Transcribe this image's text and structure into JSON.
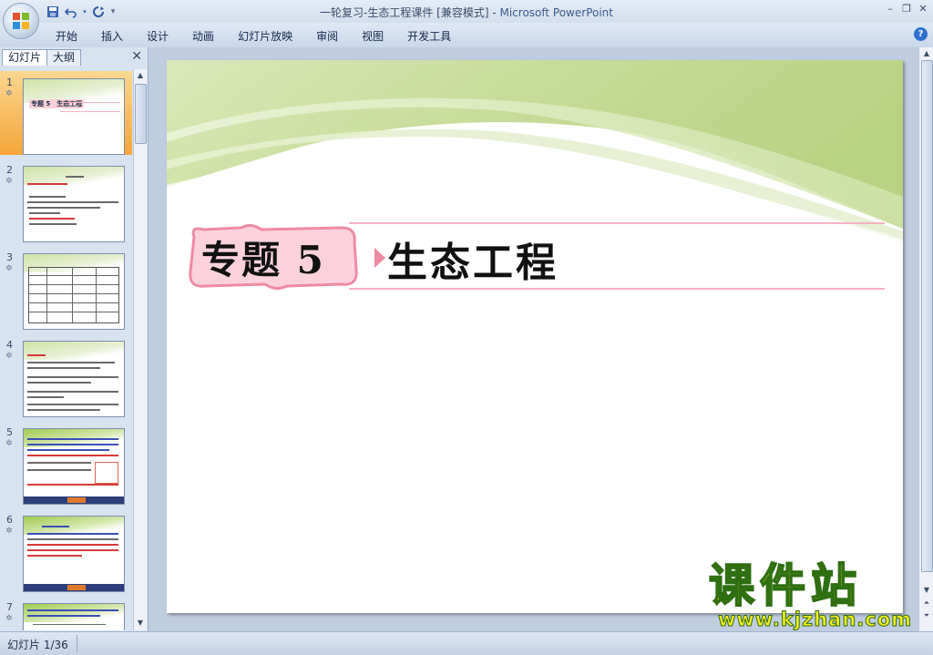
{
  "window": {
    "title_doc": "一轮复习-生态工程课件 [兼容模式] - ",
    "title_app": "Microsoft PowerPoint"
  },
  "ribbon": {
    "tabs": [
      "开始",
      "插入",
      "设计",
      "动画",
      "幻灯片放映",
      "审阅",
      "视图",
      "开发工具"
    ]
  },
  "left_panel": {
    "tabs": [
      "幻灯片",
      "大纲"
    ],
    "active_tab": "幻灯片",
    "slides": [
      {
        "number": "1",
        "title": "专题 5　生态工程",
        "selected": true
      },
      {
        "number": "2",
        "selected": false
      },
      {
        "number": "3",
        "selected": false
      },
      {
        "number": "4",
        "selected": false
      },
      {
        "number": "5",
        "selected": false
      },
      {
        "number": "6",
        "selected": false
      },
      {
        "number": "7",
        "selected": false
      }
    ]
  },
  "slide": {
    "title_num": "专题 5",
    "title_text": "生态工程",
    "accent_pink": "#f08aa3",
    "accent_green": "#c9de9b"
  },
  "status": {
    "slide_indicator": "幻灯片 1/36"
  },
  "watermark": {
    "main": "课件站",
    "url": "www.kjzhan.com"
  },
  "icons": {
    "office": "office-button-icon",
    "save": "save-icon",
    "undo": "undo-icon",
    "redo": "redo-icon",
    "help": "help-icon"
  }
}
